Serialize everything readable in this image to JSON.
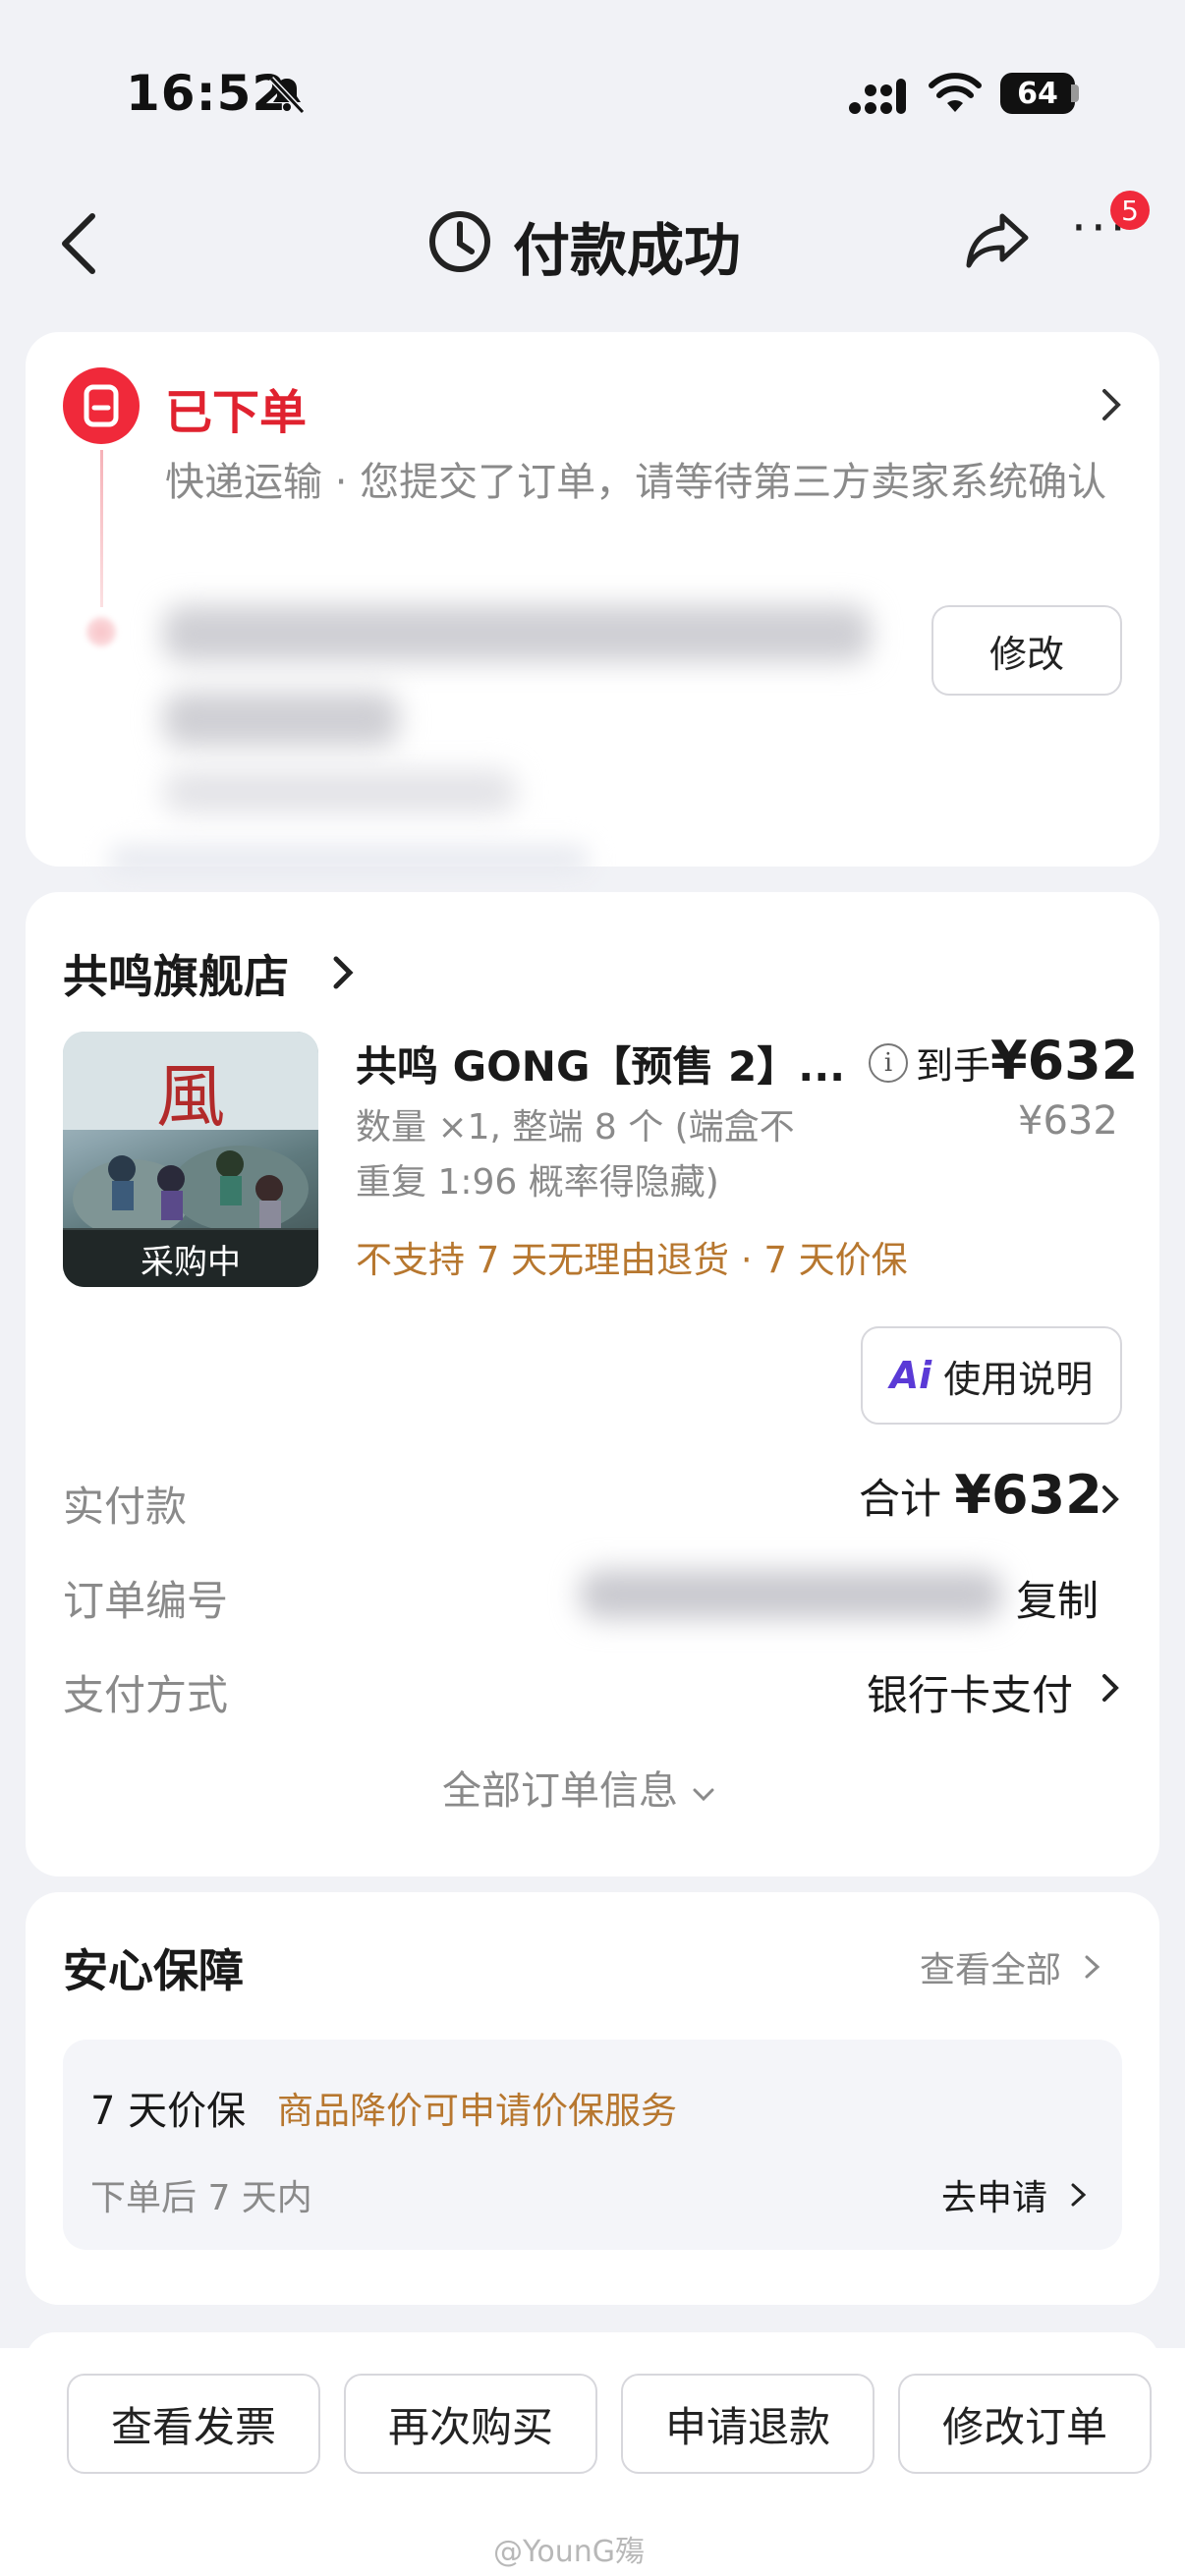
{
  "status_bar": {
    "time": "16:52",
    "battery": "64"
  },
  "nav": {
    "title": "付款成功",
    "notification_count": "5"
  },
  "order_status": {
    "title": "已下单",
    "description": "快递运输 · 您提交了订单，请等待第三方卖家系统确认",
    "modify_label": "修改"
  },
  "store": {
    "name": "共鸣旗舰店"
  },
  "product": {
    "title": "共鸣 GONG【预售 2】...",
    "description": "数量 ×1, 整端 8 个 (端盒不重复 1:96 概率得隐藏)",
    "policy": "不支持 7 天无理由退货 · 7 天价保",
    "image_label": "采购中",
    "final_price_prefix": "到手",
    "final_price": "¥632",
    "original_price": "¥632",
    "guide_button": "使用说明",
    "ai_mark": "Ai"
  },
  "details": {
    "paid_label": "实付款",
    "paid_value_prefix": "合计",
    "paid_value": "¥632",
    "order_no_label": "订单编号",
    "copy_label": "复制",
    "payment_label": "支付方式",
    "payment_value": "银行卡支付",
    "all_info": "全部订单信息"
  },
  "guarantee": {
    "title": "安心保障",
    "view_all": "查看全部",
    "item_name": "7 天价保",
    "item_desc": "商品降价可申请价保服务",
    "item_sub": "下单后 7 天内",
    "item_action": "去申请"
  },
  "bottom_actions": [
    "查看发票",
    "再次购买",
    "申请退款",
    "修改订单"
  ],
  "watermark": "@YounG殤",
  "colors": {
    "accent_red": "#e0222f",
    "policy_brown": "#b7772f",
    "muted": "#8a8a8a"
  }
}
